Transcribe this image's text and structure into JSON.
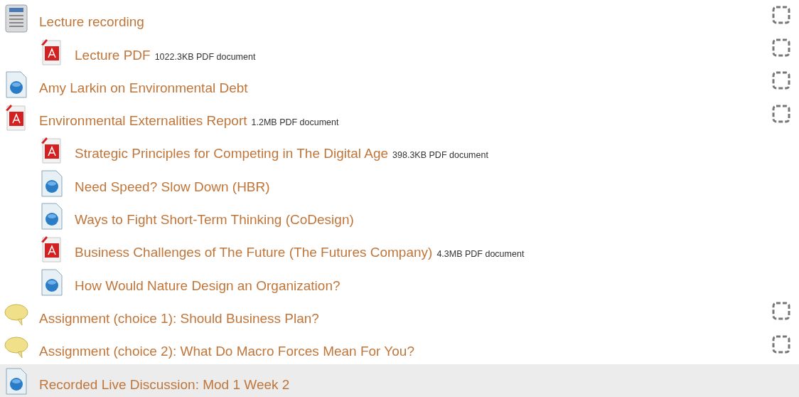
{
  "activities": [
    {
      "kind": "page",
      "title": "Lecture recording",
      "checked": false,
      "highlighted": false,
      "children": [
        {
          "kind": "pdf",
          "title": "Lecture PDF",
          "details": "1022.3KB PDF document",
          "checked": false,
          "highlighted": false
        }
      ]
    },
    {
      "kind": "url",
      "title": "Amy Larkin on Environmental Debt",
      "checked": false,
      "highlighted": false
    },
    {
      "kind": "pdf",
      "title": "Environmental Externalities Report",
      "details": "1.2MB PDF document",
      "checked": false,
      "highlighted": false,
      "children": [
        {
          "kind": "pdf",
          "title": "Strategic Principles for Competing in The Digital Age",
          "details": "398.3KB PDF document",
          "highlighted": false
        },
        {
          "kind": "url",
          "title": "Need Speed? Slow Down (HBR)",
          "highlighted": false
        },
        {
          "kind": "url",
          "title": "Ways to Fight Short-Term Thinking (CoDesign)",
          "highlighted": false
        },
        {
          "kind": "pdf",
          "title": "Business Challenges of The Future (The Futures Company)",
          "details": "4.3MB PDF document",
          "highlighted": false
        },
        {
          "kind": "url",
          "title": "How Would Nature Design an Organization?",
          "highlighted": false
        }
      ]
    },
    {
      "kind": "forum",
      "title": "Assignment (choice 1): Should Business Plan?",
      "checked": false,
      "highlighted": false
    },
    {
      "kind": "forum",
      "title": "Assignment (choice 2): What Do Macro Forces Mean For You?",
      "checked": false,
      "highlighted": false
    },
    {
      "kind": "url",
      "title": "Recorded Live Discussion: Mod 1 Week 2",
      "highlighted": true
    }
  ]
}
